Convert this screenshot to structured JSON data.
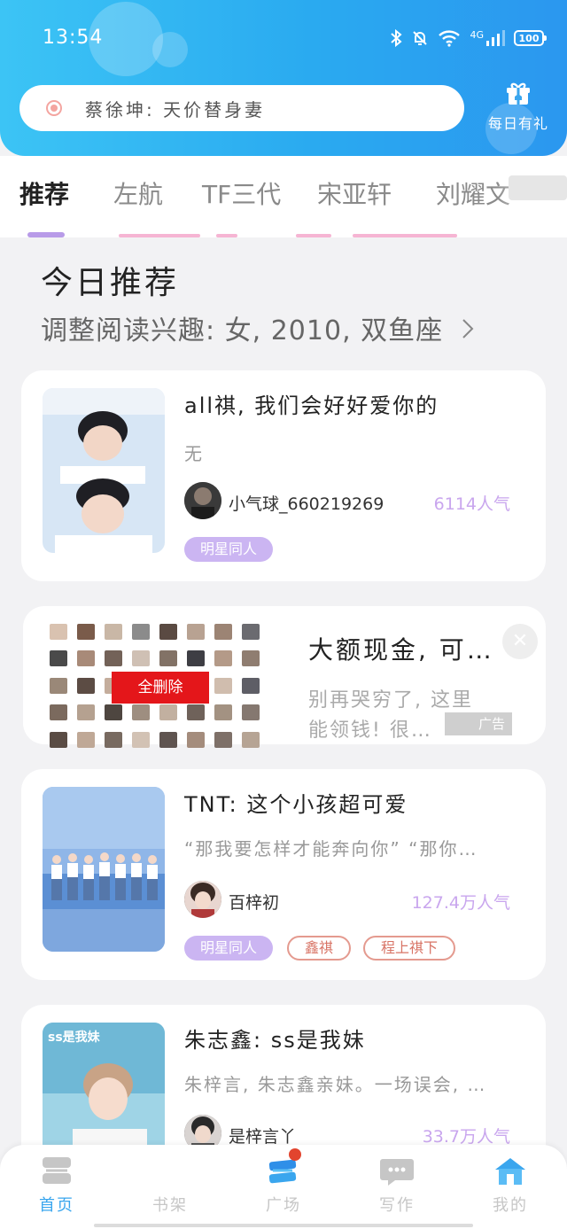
{
  "status_bar": {
    "time": "13:54",
    "network": "4G",
    "battery": "100",
    "icons": [
      "bluetooth-icon",
      "mute-icon",
      "wifi-icon",
      "signal-icon",
      "battery-icon"
    ]
  },
  "header": {
    "search_text": "蔡徐坤: 天价替身妻",
    "gift_label": "每日有礼",
    "colors": {
      "gradient_start": "#3cc4f5",
      "gradient_end": "#2b97ef"
    }
  },
  "tabs": [
    {
      "label": "推荐",
      "active": true
    },
    {
      "label": "左航",
      "active": false
    },
    {
      "label": "TF三代",
      "active": false
    },
    {
      "label": "宋亚轩",
      "active": false
    },
    {
      "label": "刘耀文",
      "active": false
    }
  ],
  "today": {
    "title": "今日推荐",
    "subtitle": "调整阅读兴趣: 女, 2010, 双鱼座"
  },
  "books": [
    {
      "title": "all祺, 我们会好好爱你的",
      "description": "无",
      "author": "小气球_660219269",
      "popularity": "6114人气",
      "tags": [
        "明星同人"
      ]
    },
    {
      "title": "TNT: 这个小孩超可爱",
      "description": "“那我要怎样才能奔向你” “那你…",
      "author": "百梓初",
      "popularity": "127.4万人气",
      "tags": [
        "明星同人",
        "鑫祺",
        "程上祺下"
      ]
    },
    {
      "title": "朱志鑫: ss是我妹",
      "description": "朱梓言, 朱志鑫亲妹。一场误会, …",
      "author": "是梓言丫",
      "popularity": "33.7万人气",
      "cover_text": "ss是我妹",
      "tags": []
    }
  ],
  "ad": {
    "title": "大额现金, 可…",
    "description": "别再哭穷了, 这里能领钱! 很…",
    "delete_badge": "全删除",
    "badge": "广告",
    "close": "✕"
  },
  "bottom_nav": [
    {
      "label": "首页",
      "icon": "home-stack-icon",
      "active": true
    },
    {
      "label": "书架",
      "icon": "bookshelf-icon",
      "active": false
    },
    {
      "label": "广场",
      "icon": "plaza-icon",
      "active": false,
      "badge_dot": true
    },
    {
      "label": "写作",
      "icon": "chat-bubble-icon",
      "active": false
    },
    {
      "label": "我的",
      "icon": "house-icon",
      "active": false
    }
  ],
  "colors": {
    "accent_purple": "#cbb5f2",
    "popularity_purple": "#c9a6ee",
    "tag_outline": "#e49a8f",
    "nav_active": "#3aa6ee",
    "delete_red": "#e4161a"
  }
}
